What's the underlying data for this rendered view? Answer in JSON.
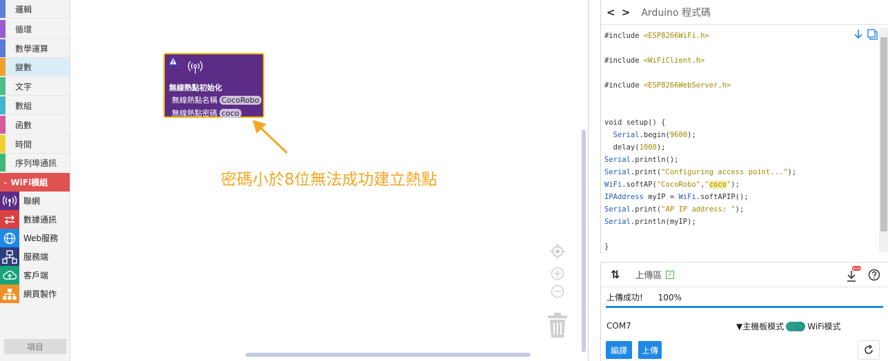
{
  "sidebar": {
    "categories": [
      {
        "label": "邏輯",
        "color": "#5b80d8"
      },
      {
        "label": "循環",
        "color": "#9a5cd6"
      },
      {
        "label": "數學運算",
        "color": "#5b7ad6"
      },
      {
        "label": "變數",
        "color": "#f0a030"
      },
      {
        "label": "文字",
        "color": "#4cbd8c"
      },
      {
        "label": "數組",
        "color": "#45b5c9"
      },
      {
        "label": "函數",
        "color": "#d65c9a"
      },
      {
        "label": "時間",
        "color": "#f0d030"
      },
      {
        "label": "序列埠通訊",
        "color": "#3cb878"
      }
    ],
    "wifi_group": {
      "label": "WiFi模組",
      "color": "#e05252"
    },
    "wifi_items": [
      {
        "label": "聯網",
        "icon": "antenna-icon",
        "color": "#5b2d86"
      },
      {
        "label": "數據通訊",
        "icon": "exchange-icon",
        "color": "#d94040"
      },
      {
        "label": "Web服務",
        "icon": "globe-icon",
        "color": "#1e88e5"
      },
      {
        "label": "服務端",
        "icon": "server-tree-icon",
        "color": "#2c3e7a"
      },
      {
        "label": "客戶端",
        "icon": "cloud-upload-icon",
        "color": "#1aa37a"
      },
      {
        "label": "網頁製作",
        "icon": "sitemap-icon",
        "color": "#f0902a"
      }
    ],
    "items_button": "項目"
  },
  "workspace": {
    "block": {
      "title": "無線熱點初始化",
      "ssid_label": "無線熱點名稱",
      "ssid_value": "CocoRobo",
      "pwd_label": "無線熱點密碼",
      "pwd_value": "coco",
      "color": "#5b2d86",
      "warning_color": "#f0b400"
    },
    "annotation": "密碼小於8位無法成功建立熱點",
    "annotation_color": "#f5a623"
  },
  "code_panel": {
    "nav": "< >",
    "title": "Arduino 程式碼",
    "lines": [
      "#include <ESP8266WiFi.h>",
      "",
      "#include <WiFiClient.h>",
      "",
      "#include <ESP8266WebServer.h>",
      "",
      "",
      "void setup() {",
      "  Serial.begin(9600);",
      "  delay(1000);",
      "Serial.println();",
      "Serial.print(\"Configuring access point...\");",
      "WiFi.softAP(\"CocoRobo\",\"coco\");",
      "IPAddress myIP = WiFi.softAPIP();",
      "Serial.print(\"AP IP address: \");",
      "Serial.println(myIP);",
      "",
      "}"
    ]
  },
  "upload_panel": {
    "arrows": "⇅",
    "title": "上傳區",
    "status": "上傳成功!",
    "percent": "100%",
    "progress": 1.0,
    "port": "COM7",
    "mode_left": "▼主機板模式",
    "mode_right": "WiFi模式",
    "compile_button": "編譯",
    "upload_button": "上傳",
    "new_badge": "NEW",
    "accent": "#1e88e5"
  }
}
